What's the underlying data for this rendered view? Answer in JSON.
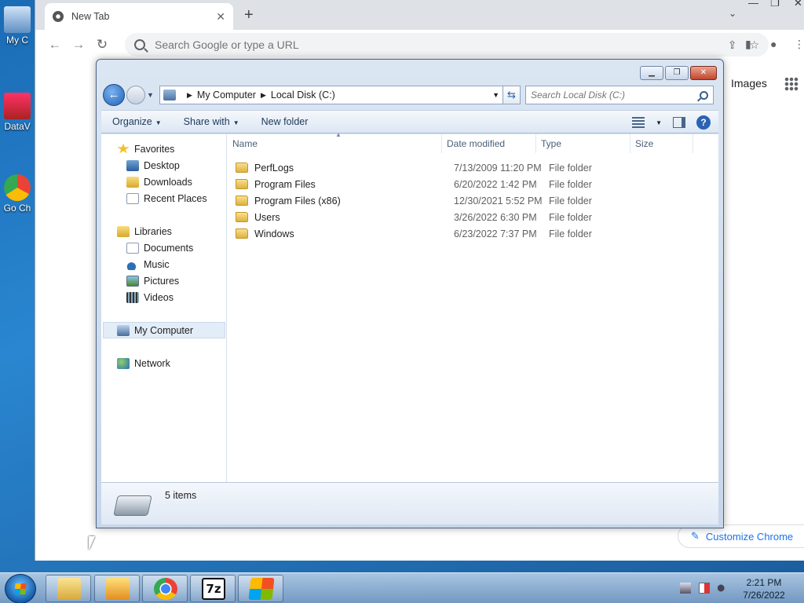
{
  "desktop": {
    "icons": [
      {
        "label": "My C"
      },
      {
        "label": "DataV"
      },
      {
        "label": "Go Ch"
      }
    ]
  },
  "chrome": {
    "tab": {
      "title": "New Tab"
    },
    "omnibox": {
      "placeholder": "Search Google or type a URL"
    },
    "content": {
      "images_link": "Images",
      "customize_label": "Customize Chrome"
    }
  },
  "explorer": {
    "address": {
      "segments": [
        "My Computer",
        "Local Disk (C:)"
      ]
    },
    "search": {
      "placeholder": "Search Local Disk (C:)"
    },
    "commands": {
      "organize": "Organize",
      "share_with": "Share with",
      "new_folder": "New folder"
    },
    "nav": {
      "favorites": "Favorites",
      "desktop": "Desktop",
      "downloads": "Downloads",
      "recent_places": "Recent Places",
      "libraries": "Libraries",
      "documents": "Documents",
      "music": "Music",
      "pictures": "Pictures",
      "videos": "Videos",
      "my_computer": "My Computer",
      "network": "Network"
    },
    "columns": {
      "name": "Name",
      "date_modified": "Date modified",
      "type": "Type",
      "size": "Size"
    },
    "files": [
      {
        "name": "PerfLogs",
        "date": "7/13/2009 11:20 PM",
        "type": "File folder"
      },
      {
        "name": "Program Files",
        "date": "6/20/2022 1:42 PM",
        "type": "File folder"
      },
      {
        "name": "Program Files (x86)",
        "date": "12/30/2021 5:52 PM",
        "type": "File folder"
      },
      {
        "name": "Users",
        "date": "3/26/2022 6:30 PM",
        "type": "File folder"
      },
      {
        "name": "Windows",
        "date": "6/23/2022 7:37 PM",
        "type": "File folder"
      }
    ],
    "details": {
      "items_count": "5 items"
    }
  },
  "taskbar": {
    "clock": {
      "time": "2:21 PM",
      "date": "7/26/2022"
    },
    "buttons": {
      "sevenzip": "7z"
    }
  }
}
